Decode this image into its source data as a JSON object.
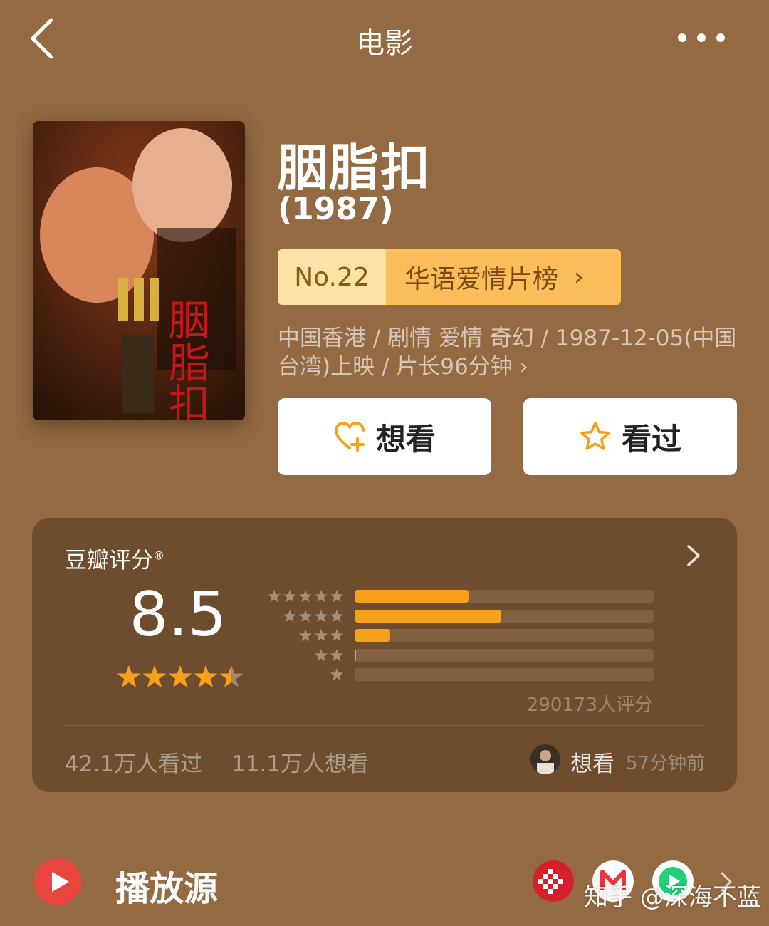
{
  "header": {
    "title": "电影",
    "back_icon": "chevron-left-icon",
    "more_icon": "more-dots-icon"
  },
  "movie": {
    "title": "胭脂扣",
    "year": "(1987)",
    "poster_text": [
      "胭",
      "脂",
      "扣"
    ],
    "rank": {
      "no": "No.22",
      "list": "华语爱情片榜",
      "chevron": "›"
    },
    "meta": "中国香港 / 剧情 爱情 奇幻 / 1987-12-05(中国台湾)上映 / 片长96分钟 ›"
  },
  "actions": {
    "want": {
      "label": "想看",
      "icon": "heart-plus-icon"
    },
    "seen": {
      "label": "看过",
      "icon": "star-outline-icon"
    }
  },
  "rating": {
    "label": "豆瓣评分",
    "registered_mark": "®",
    "score": "8.5",
    "score_stars": 4.5,
    "distribution": [
      {
        "stars": 5,
        "fraction": 0.38
      },
      {
        "stars": 4,
        "fraction": 0.49
      },
      {
        "stars": 3,
        "fraction": 0.12
      },
      {
        "stars": 2,
        "fraction": 0.005
      },
      {
        "stars": 1,
        "fraction": 0.0
      }
    ],
    "count_text": "290173人评分",
    "seen_text": "42.1万人看过",
    "want_text": "11.1万人想看",
    "friend": {
      "action": "想看",
      "time": "57分钟前"
    }
  },
  "play_sources": {
    "label": "播放源",
    "logos": [
      "youku-icon",
      "mgtv-icon",
      "iqiyi-icon"
    ]
  },
  "watermark": "知乎 @深海不蓝",
  "colors": {
    "background": "#946a43",
    "card": "#6e4d2e",
    "accent": "#f5a11c",
    "play_red": "#e8463e"
  }
}
